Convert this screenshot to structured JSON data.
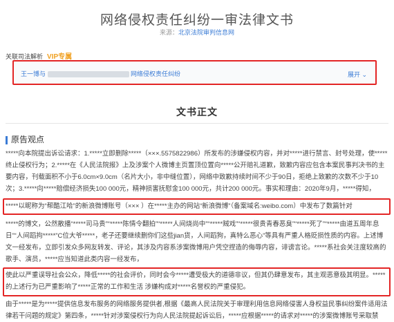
{
  "document": {
    "title": "网络侵权责任纠纷一审法律文书",
    "source_label": "来源：",
    "source_name": "北京法院审判信息网"
  },
  "association": {
    "label": "关联司法解析",
    "vip": "VIP专属"
  },
  "case_link": {
    "prefix": "王一博与",
    "suffix": "网络侵权责任纠纷",
    "expand_label": "展开 ⌄"
  },
  "section_title": "文书正文",
  "sub_heading": "原告观点",
  "paragraphs": {
    "p1": "*****向本院提出诉讼请求：1.*****立即删除*****（×××.5575822986）所发布的涉嫌侵权内容，并对*****进行禁言、封号处理，使*****终止侵权行为；2.*****在《人民法院报》上及涉案个人微博主页置顶位置向*****公开赔礼道歉，致歉内容应包含本案民事判决书的主要内容，刊载面积不小于6.0cm×9.0cm（名片大小，非中缝位置），网络中致歉持续时间不少于90日，拒绝上致歉的次数不少于10次；3.*****向*****赔偿经济损失100 000元，精神损害抚慰金100 000元，共计200 000元。事实和理由：2020年9月，*****得知，",
    "p2": "*****以昵称为“帮酷江哈”的新浪微博账号（×××              ）在*****主办的网站“新浪微博”（备案域名:weibo.com）中发布了数篇针对",
    "p3": "*****的博文，公然散播“*****司马贵”“*****陈情令翻拍”“*****人间烧尚中”“*****贼戏”“*****很贵青春恶臭”“*****死了”“*****由道五周年息日”“人间蹈拘*****”C位大爷*****，老子还要继续删你们这些jian货，人间蹈狗，真特么恶心”等具有严重人格贬损性质的内容。上述博文一经发布，立即引发众多网友转发、评论，其涉及内容系涉案微博用户凭空捏造的侮辱内容，诽谤言论。*****系社会关注度较高的歌手、演员，*****应当知道此类内容一经发布，",
    "p4": "使此以严重误导社会公众，降低*****的社会评价，同时会今*****遭受极大的道德非议，但其仍肆意发布，其主观恶意极其明显。*****的上述行为已严重影响了*****正常的工作和生活 涉嫌构成对*****名誉权的严重侵犯。",
    "p5": "由于*****是为*****提供信息发布服务的网络服务提供者,根据《最高人民法院关于审理利用信息网络侵害人身权益民事纠纷案件适用法律若干问题的规定》第四条，*****针对涉案侵权行为向人民法院提起诉讼后，*****应根据*****的请求对*****的涉案微博账号采取禁言，封号"
  }
}
